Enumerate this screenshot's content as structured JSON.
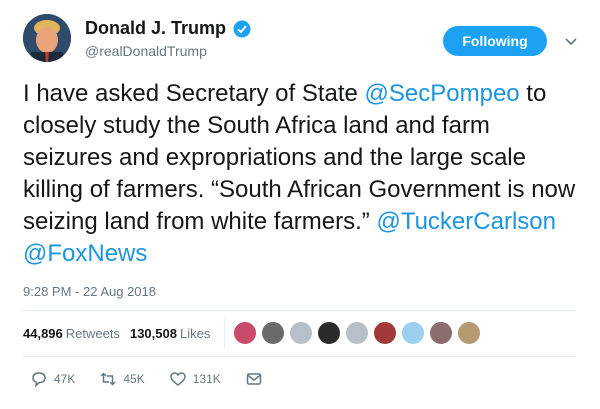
{
  "author": {
    "display_name": "Donald J. Trump",
    "handle": "@realDonaldTrump",
    "verified": true
  },
  "follow_button": {
    "label": "Following"
  },
  "tweet": {
    "segments": [
      {
        "text": "I have asked Secretary of State ",
        "type": "text"
      },
      {
        "text": "@SecPompeo",
        "type": "mention"
      },
      {
        "text": " to closely study the South Africa land and farm seizures and expropriations and the large scale killing of farmers. “South African Government is now seizing land from white farmers.” ",
        "type": "text"
      },
      {
        "text": "@TuckerCarlson",
        "type": "mention"
      },
      {
        "text": " ",
        "type": "text"
      },
      {
        "text": "@FoxNews",
        "type": "mention"
      }
    ],
    "timestamp": "9:28 PM - 22 Aug 2018"
  },
  "stats": {
    "retweets_count": "44,896",
    "retweets_label": "Retweets",
    "likes_count": "130,508",
    "likes_label": "Likes"
  },
  "likers": [
    {
      "name": "liker-1",
      "color": "#c94b6a"
    },
    {
      "name": "liker-2",
      "color": "#6b6b6b"
    },
    {
      "name": "liker-3",
      "color": "#b7c0c8"
    },
    {
      "name": "liker-4",
      "color": "#2a2a2a"
    },
    {
      "name": "liker-5",
      "color": "#b7c0c8"
    },
    {
      "name": "liker-6",
      "color": "#a33a3a"
    },
    {
      "name": "liker-7",
      "color": "#9bd0f0"
    },
    {
      "name": "liker-8",
      "color": "#8a6d6d"
    },
    {
      "name": "liker-9",
      "color": "#b59a72"
    }
  ],
  "actions": {
    "reply_count": "47K",
    "retweet_count": "45K",
    "like_count": "131K"
  },
  "colors": {
    "accent": "#1da1f2",
    "mention": "#1b95e0",
    "secondary_text": "#657786"
  }
}
